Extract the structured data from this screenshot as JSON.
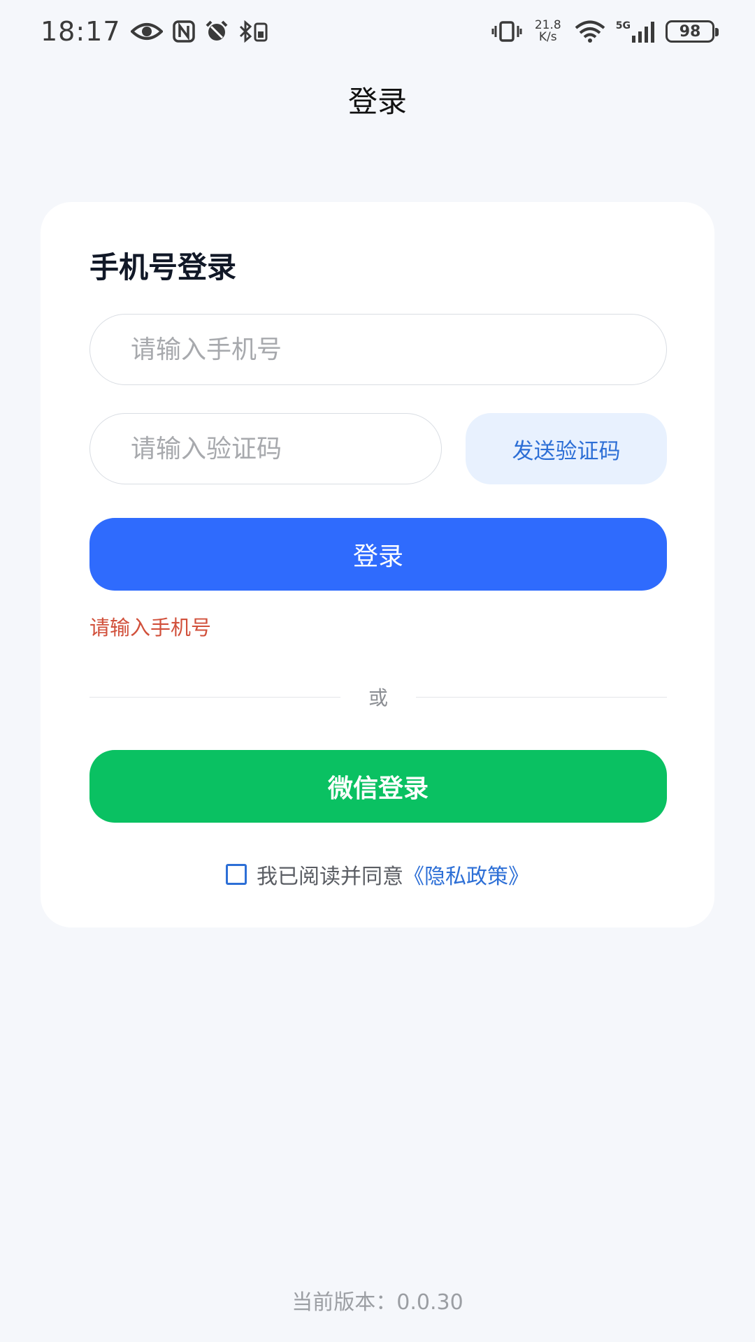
{
  "status_bar": {
    "time": "18:17",
    "net_speed_value": "21.8",
    "net_speed_unit": "K/s",
    "signal_label": "5G",
    "battery": "98",
    "icons": [
      "eye-icon",
      "nfc-icon",
      "alarm-icon",
      "bluetooth-icon",
      "vibrate-icon",
      "wifi-icon",
      "cellular-signal-icon"
    ]
  },
  "nav": {
    "title": "登录"
  },
  "card": {
    "title": "手机号登录",
    "phone_placeholder": "请输入手机号",
    "code_placeholder": "请输入验证码",
    "send_code_label": "发送验证码",
    "login_label": "登录",
    "error_message": "请输入手机号",
    "divider_label": "或",
    "wechat_label": "微信登录",
    "agreement_text": "我已阅读并同意",
    "policy_link": "《隐私政策》"
  },
  "footer": {
    "version": "当前版本：0.0.30"
  },
  "colors": {
    "primary": "#2f6bfd",
    "wechat": "#0ac162",
    "error": "#d1503b",
    "link": "#2d6fd6"
  }
}
